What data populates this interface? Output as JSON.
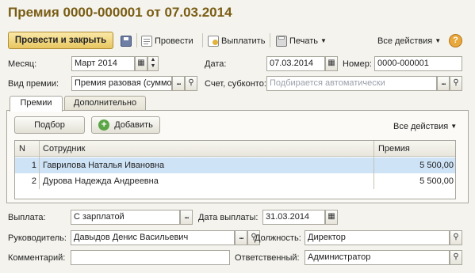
{
  "title": "Премия 0000-000001 от 07.03.2014",
  "toolbar": {
    "post_and_close": "Провести и закрыть",
    "post": "Провести",
    "pay": "Выплатить",
    "print": "Печать",
    "all_actions": "Все действия",
    "help": "?"
  },
  "header": {
    "month_label": "Месяц:",
    "month_value": "Март 2014",
    "date_label": "Дата:",
    "date_value": "07.03.2014",
    "number_label": "Номер:",
    "number_value": "0000-000001",
    "bonus_type_label": "Вид премии:",
    "bonus_type_value": "Премия разовая (суммо",
    "account_label": "Счет, субконто:",
    "account_placeholder": "Подбирается автоматически"
  },
  "tabs": [
    {
      "label": "Премии",
      "active": true
    },
    {
      "label": "Дополнительно",
      "active": false
    }
  ],
  "panel": {
    "select_button": "Подбор",
    "add_button": "Добавить",
    "all_actions": "Все действия"
  },
  "table": {
    "columns": [
      "N",
      "Сотрудник",
      "Премия"
    ],
    "rows": [
      {
        "n": "1",
        "employee": "Гаврилова Наталья Ивановна",
        "amount": "5 500,00",
        "selected": true
      },
      {
        "n": "2",
        "employee": "Дурова Надежда Андреевна",
        "amount": "5 500,00",
        "selected": false
      }
    ]
  },
  "footer": {
    "payout_label": "Выплата:",
    "payout_value": "С зарплатой",
    "payout_date_label": "Дата выплаты:",
    "payout_date_value": "31.03.2014",
    "manager_label": "Руководитель:",
    "manager_value": "Давыдов Денис Васильевич",
    "position_label": "Должность:",
    "position_value": "Директор",
    "comment_label": "Комментарий:",
    "comment_value": "",
    "responsible_label": "Ответственный:",
    "responsible_value": "Администратор"
  },
  "colors": {
    "title": "#7a5d14",
    "primary_button": "#e8c660",
    "selected_row": "#cfe3f6",
    "background": "#f4f3ee"
  }
}
